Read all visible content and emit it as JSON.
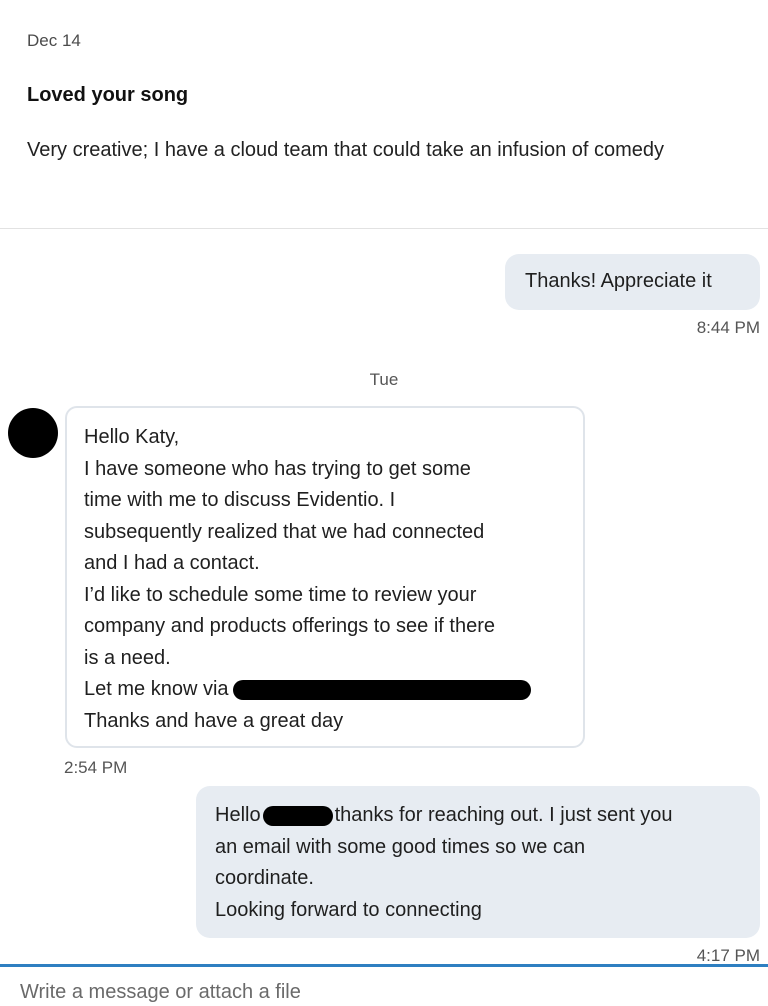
{
  "inmail": {
    "date": "Dec 14",
    "subject": "Loved your song",
    "body": "Very creative; I have a cloud team that could take an infusion of comedy"
  },
  "messages": [
    {
      "text": "Thanks! Appreciate it",
      "time": "8:44 PM"
    },
    {
      "day": "Tue",
      "lines": [
        "Hello Katy,",
        "I have someone who has trying to get some",
        "time with me to discuss Evidentio. I",
        "subsequently realized that we had connected",
        "and I had a contact.",
        "I’d like to schedule some time to review your",
        "company and products offerings to see if there",
        "is a need.",
        "Let me know via",
        "Thanks and have a great day"
      ],
      "time": "2:54 PM"
    },
    {
      "hello": "Hello",
      "line1_rest": "thanks for reaching out. I just sent you",
      "lines": [
        "an email with some good times so we can",
        "coordinate.",
        "Looking forward to connecting"
      ],
      "time": "4:17 PM"
    }
  ],
  "composer": {
    "placeholder": "Write a message or attach a file"
  }
}
